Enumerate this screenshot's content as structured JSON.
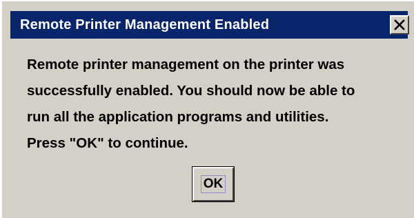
{
  "dialog": {
    "title": "Remote Printer Management Enabled",
    "close_icon": "close-icon",
    "message_lines": [
      "Remote printer management on the printer was",
      "successfully enabled. You should now be able to",
      "run all the application programs and utilities.",
      "Press \"OK\" to continue."
    ],
    "ok_label": "OK"
  },
  "colors": {
    "titlebar": "#08246b",
    "title_text": "#ffffff",
    "body_background": "#d4d0c8"
  }
}
